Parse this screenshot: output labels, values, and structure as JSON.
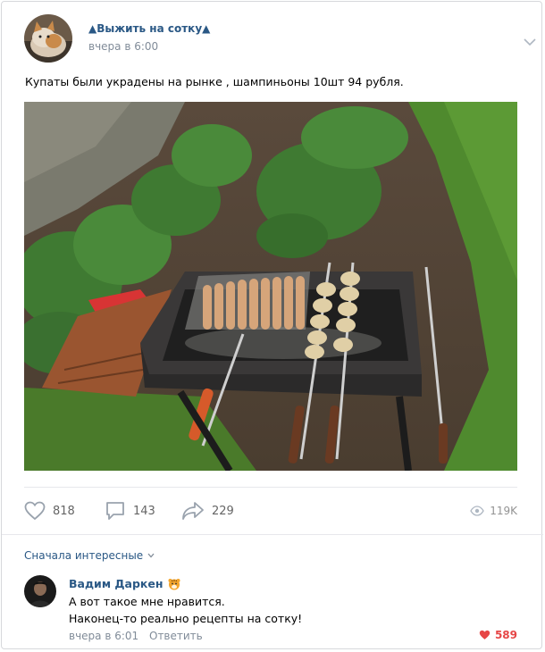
{
  "post": {
    "group_name": "▲Выжить на сотку▲",
    "time": "вчера в 6:00",
    "text": "Купаты были украдены на рынке , шампиньоны 10шт 94 рубля."
  },
  "actions": {
    "likes": "818",
    "comments": "143",
    "shares": "229",
    "views": "119K"
  },
  "comments_section": {
    "sort_label": "Сначала интересные",
    "comment": {
      "author": "Вадим Даркен",
      "line1": "А вот такое мне нравится.",
      "line2": "Наконец-то реально рецепты на сотку!",
      "time": "вчера в 6:01",
      "reply_label": "Ответить",
      "likes": "589"
    }
  },
  "colors": {
    "link": "#2a5885",
    "meta": "#818c99",
    "like_red": "#e64646"
  }
}
